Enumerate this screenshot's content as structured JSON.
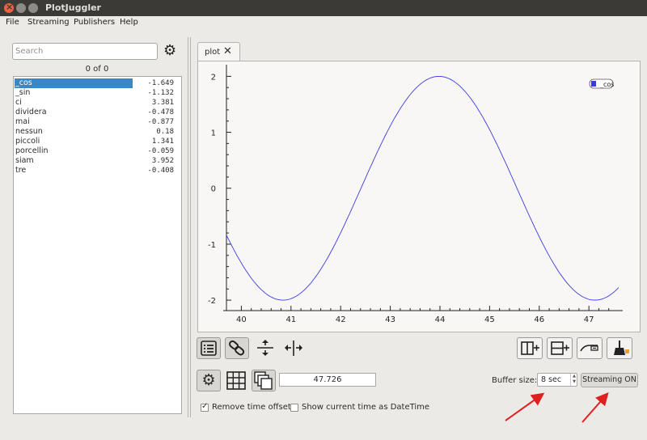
{
  "window": {
    "title": "PlotJuggler"
  },
  "menu": [
    "File",
    "Streaming",
    "Publishers",
    "Help"
  ],
  "sidebar": {
    "search_placeholder": "Search",
    "count": "0 of 0",
    "items": [
      {
        "name": "_cos",
        "value": "-1.649"
      },
      {
        "name": "_sin",
        "value": "-1.132"
      },
      {
        "name": "ci",
        "value": "3.381"
      },
      {
        "name": "dividera",
        "value": "-0.478"
      },
      {
        "name": "mai",
        "value": "-0.877"
      },
      {
        "name": "nessun",
        "value": "0.18"
      },
      {
        "name": "piccoli",
        "value": "1.341"
      },
      {
        "name": "porcellin",
        "value": "-0.059"
      },
      {
        "name": "siam",
        "value": "3.952"
      },
      {
        "name": "tre",
        "value": "-0.408"
      }
    ],
    "selected": 0
  },
  "tabs": [
    {
      "label": "plot",
      "close": "✕"
    }
  ],
  "chart_data": {
    "type": "line",
    "title": "",
    "xlabel": "",
    "ylabel": "",
    "xlim": [
      39.7,
      47.6
    ],
    "ylim": [
      -2.1,
      2.15
    ],
    "xticks": [
      "40",
      "41",
      "42",
      "43",
      "44",
      "45",
      "46",
      "47"
    ],
    "yticks": [
      "2",
      "1",
      "0",
      "-1",
      "-2"
    ],
    "legend": {
      "placement": "top-right"
    },
    "series": [
      {
        "name": "_cos",
        "color": "#3b3bdb",
        "function": "2*cos(x)",
        "x": [
          39.7,
          40.0,
          40.5,
          40.84,
          41.5,
          42.0,
          42.5,
          43.0,
          43.5,
          43.98,
          44.5,
          45.0,
          45.5,
          46.0,
          46.5,
          47.12,
          47.6
        ],
        "y": [
          -0.88,
          -1.33,
          -1.86,
          -2.0,
          -1.61,
          -0.8,
          0.15,
          1.08,
          1.77,
          2.0,
          1.74,
          1.05,
          0.04,
          -0.89,
          -1.66,
          -2.0,
          -1.65
        ]
      }
    ]
  },
  "toolbar": {
    "time_value": "47.726",
    "buffer_label": "Buffer size:",
    "buffer_value": "8 sec",
    "streaming_label": "Streaming ON",
    "remove_offset_label": "Remove time offset",
    "remove_offset_checked": true,
    "show_datetime_label": "Show current time as DateTime",
    "show_datetime_checked": false,
    "check_glyph": "✓",
    "gear_glyph": "⚙"
  },
  "annotations": {
    "arrow_color": "#e02020"
  }
}
